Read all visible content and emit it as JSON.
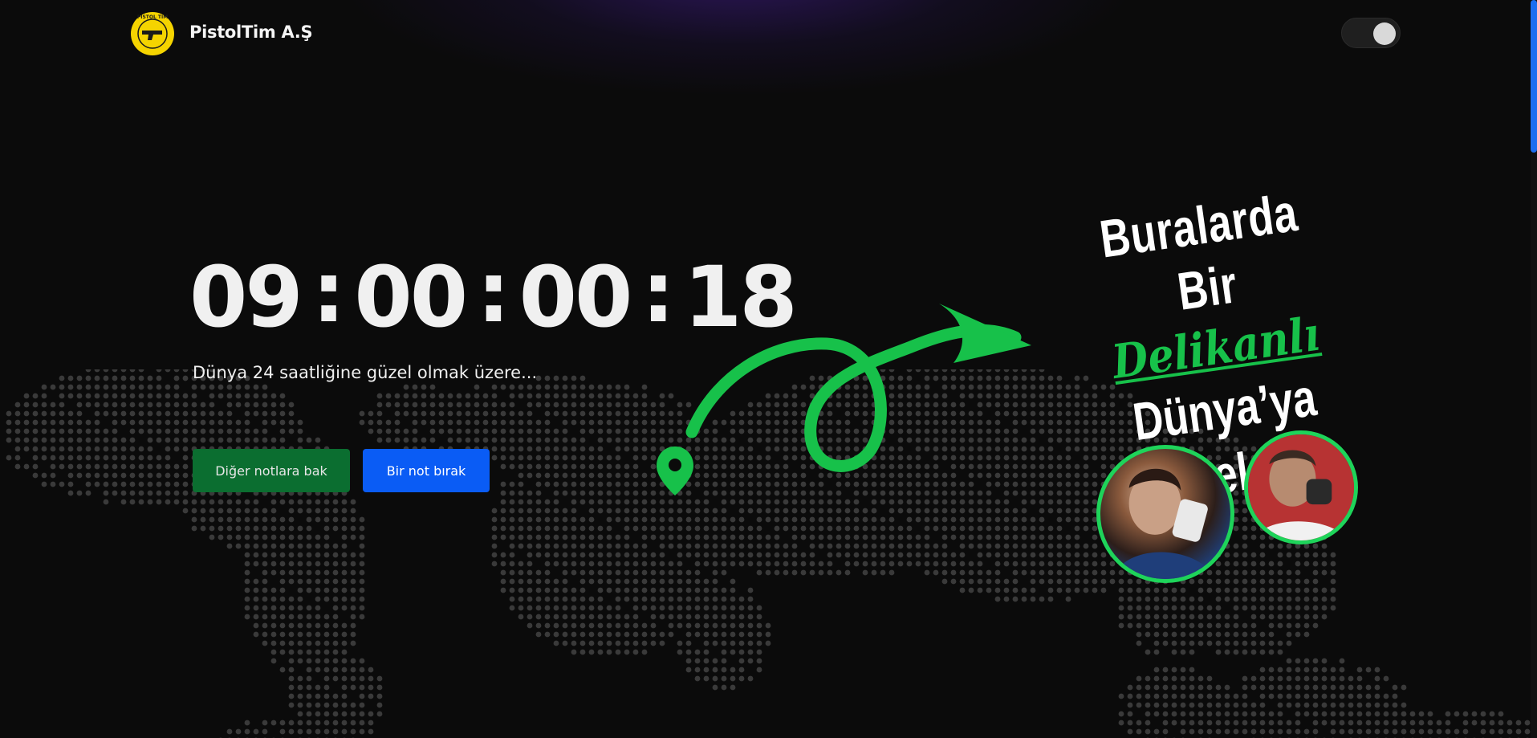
{
  "brand": {
    "name": "PistolTim A.Ş",
    "logo_text": "PISTOL TIM",
    "logo_icon": "pistol-icon"
  },
  "theme_toggle": {
    "state": "on"
  },
  "countdown": {
    "days": "09",
    "hours": "00",
    "minutes": "00",
    "seconds": "18",
    "separator": ":"
  },
  "subtitle": "Dünya 24 saatliğine güzel olmak üzere...",
  "buttons": {
    "other_notes": "Diğer notlara bak",
    "leave_note": "Bir not bırak"
  },
  "headline": {
    "line1": "Buralarda Bir",
    "line2": "Delikanlı",
    "line3": "Dünya’ya Geldi"
  },
  "icons": {
    "location": "map-pin-icon",
    "arrow": "curly-arrow-icon"
  },
  "colors": {
    "background": "#0b0b0b",
    "accent_green": "#17c14a",
    "button_green": "#0b6e30",
    "button_blue": "#0a5cf5",
    "logo_yellow": "#f5d400"
  }
}
